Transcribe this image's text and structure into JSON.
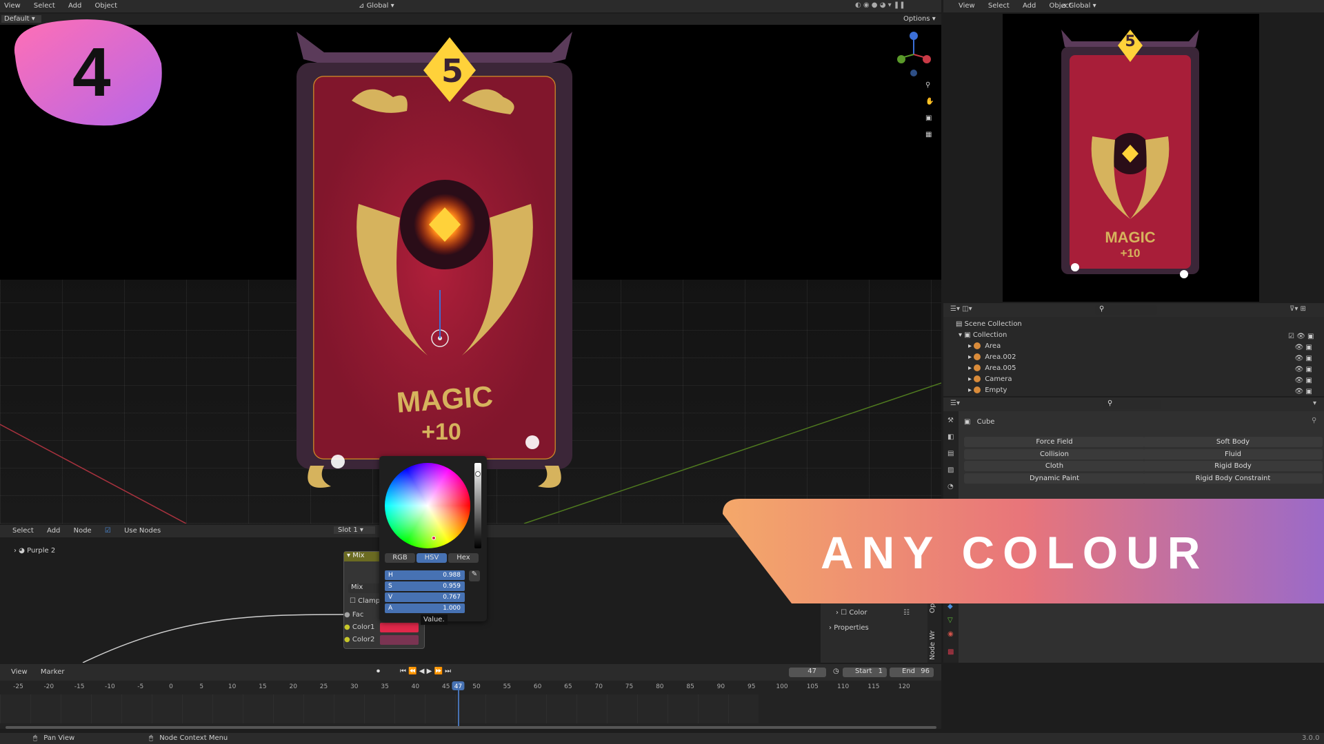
{
  "badge": {
    "number": "4",
    "gradient_from": "#ff6fb5",
    "gradient_to": "#b766e8"
  },
  "viewport_header": {
    "menu": [
      "View",
      "Select",
      "Add",
      "Object"
    ],
    "orientation": "Global",
    "mode": "Default",
    "options": "Options"
  },
  "card": {
    "cost": "5",
    "title": "MAGIC",
    "value": "+10",
    "colors": {
      "body": "#b01f3b",
      "frame": "#4a3047",
      "gold": "#d6b35d",
      "gem": "#ffd23a"
    }
  },
  "render_header": {
    "menu": [
      "View",
      "Select",
      "Add",
      "Object"
    ],
    "orientation": "Global"
  },
  "render_preview": {
    "title": "MAGIC",
    "value": "+10",
    "cost": "5"
  },
  "outliner": {
    "scene": "Scene Collection",
    "collection": "Collection",
    "items": [
      "Area",
      "Area.002",
      "Area.005",
      "Camera",
      "Empty"
    ]
  },
  "properties": {
    "object": "Cube",
    "physics_left": [
      "Force Field",
      "Collision",
      "Cloth",
      "Dynamic Paint"
    ],
    "physics_right": [
      "Soft Body",
      "Fluid",
      "Rigid Body",
      "Rigid Body Constraint"
    ],
    "sections": [
      "Color",
      "Properties"
    ],
    "side_tabs": [
      "Opt",
      "Node Wr"
    ]
  },
  "banner": {
    "text": "ANY COLOUR",
    "gradient_from": "#f4a86a",
    "gradient_mid": "#e8757a",
    "gradient_to": "#9b6ac8"
  },
  "node_editor": {
    "menu": [
      "Select",
      "Add",
      "Node"
    ],
    "use_nodes": "Use Nodes",
    "slot": "Slot 1",
    "material": "Purple 2",
    "node": {
      "title": "Mix",
      "blend": "Mix",
      "clamp": "Clamp",
      "inputs": [
        "Fac",
        "Color1",
        "Color2"
      ],
      "color1": "#e0284a",
      "color2": "#7a3452"
    }
  },
  "color_picker": {
    "modes": [
      "RGB",
      "HSV",
      "Hex"
    ],
    "active_mode": "HSV",
    "fields": [
      {
        "label": "H",
        "value": "0.988"
      },
      {
        "label": "S",
        "value": "0.959"
      },
      {
        "label": "V",
        "value": "0.767"
      },
      {
        "label": "A",
        "value": "1.000"
      }
    ],
    "tooltip": "Value."
  },
  "timeline": {
    "menu": [
      "View",
      "Marker"
    ],
    "current_frame": "47",
    "start_label": "Start",
    "start": "1",
    "end_label": "End",
    "end": "96",
    "ticks": [
      "-25",
      "-20",
      "-15",
      "-10",
      "-5",
      "0",
      "5",
      "10",
      "15",
      "20",
      "25",
      "30",
      "35",
      "40",
      "45",
      "47",
      "50",
      "55",
      "60",
      "65",
      "70",
      "75",
      "80",
      "85",
      "90",
      "95",
      "100",
      "105",
      "110",
      "115",
      "120"
    ]
  },
  "status_bar": {
    "left": "Pan View",
    "middle": "Node Context Menu",
    "version": "3.0.0"
  }
}
